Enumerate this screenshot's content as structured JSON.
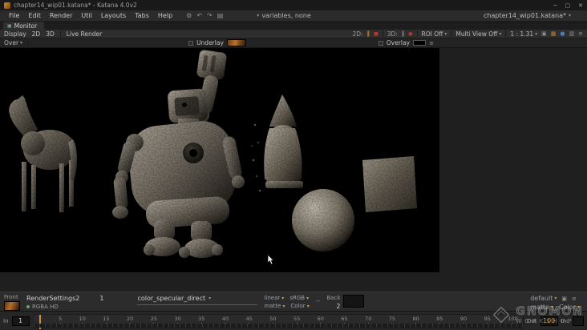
{
  "window": {
    "title": "chapter14_wip01.katana* - Katana 4.0v2",
    "minimize": "─",
    "maximize": "▢",
    "close": "✕"
  },
  "menubar": {
    "items": [
      "File",
      "Edit",
      "Render",
      "Util",
      "Layouts",
      "Tabs",
      "Help"
    ],
    "variables": "variables, none",
    "current_file": "chapter14_wip01.katana*"
  },
  "panel_tab": {
    "label": "Monitor"
  },
  "toolbar": {
    "display": "Display",
    "d2": "2D",
    "d3": "3D",
    "live_render": "Live Render",
    "label_2d": "2D:",
    "label_3d": "3D:",
    "roi": "ROI Off",
    "multi_view": "Multi View Off",
    "aspect": "1 : 1.31"
  },
  "comp_row": {
    "over": "Over",
    "underlay": "Underlay",
    "overlay": "Overlay"
  },
  "buffer_bar": {
    "front_label": "Front",
    "front_name": "RenderSettings2",
    "front_frame": "1",
    "front_channels": "RGBA HD",
    "aov": "color_specular_direct",
    "front_colorspace": "linear",
    "front_display": "sRGB",
    "front_matte": "matte",
    "front_channel": "Color",
    "separator": "--",
    "back_label": "Back",
    "back_frame": "2",
    "back_name": "default",
    "back_matte": "matte",
    "back_channel": "Color"
  },
  "timeline": {
    "in_label": "In",
    "current_frame": "1",
    "ticks": [
      "1",
      "5",
      "10",
      "15",
      "20",
      "25",
      "30",
      "35",
      "40",
      "45",
      "50",
      "55",
      "60",
      "65",
      "70",
      "75",
      "80",
      "85",
      "90",
      "95",
      "100"
    ],
    "out_label": "Out",
    "out_value": "100",
    "inc_label": "Inc"
  },
  "watermark": {
    "line1": "GNOMON",
    "line2": "WORKSHOP"
  },
  "colors": {
    "accent": "#d08a2e",
    "record_red": "#b33a2f",
    "viewport_bg": "#000000"
  }
}
